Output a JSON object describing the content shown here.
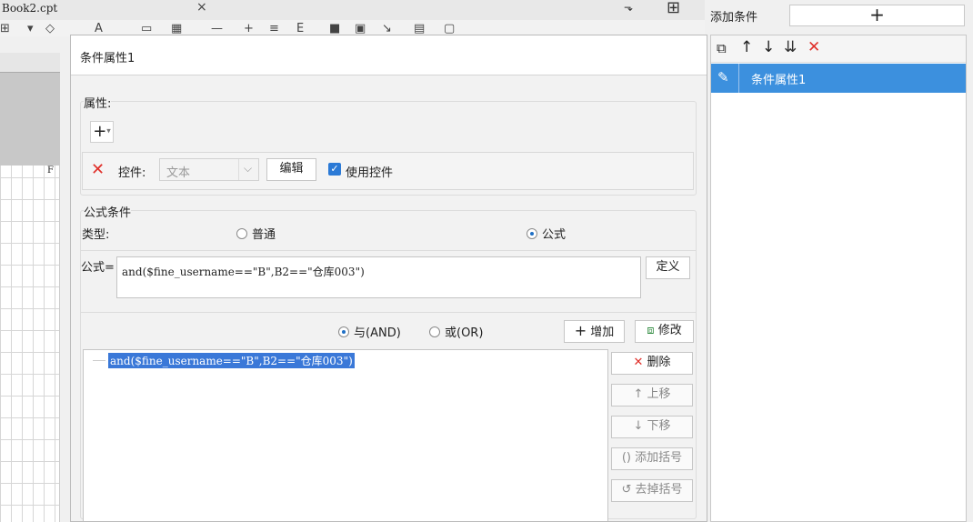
{
  "background": {
    "tab_title": "Book2.cpt",
    "tab_close": "×",
    "pin_glyph": "⬎",
    "layout_glyph": "⊞",
    "toolbar_glyphs": [
      "⊞",
      "▾",
      "◇",
      "A",
      "▭",
      "▦",
      "—",
      "+",
      "≡",
      "E",
      "■",
      "▣",
      "↘",
      "▤",
      "▢"
    ],
    "column_header": "F"
  },
  "right_panel": {
    "add_condition_label": "添加条件",
    "add_condition_button": "+",
    "tools": {
      "copy": "⧉",
      "move_up": "↑",
      "move_down": "↓",
      "move_bottom": "⇊",
      "delete": "✕"
    },
    "items": [
      {
        "label": "条件属性1",
        "icon": "pencil-icon",
        "selected": true
      }
    ],
    "selected_color": "#3c90de"
  },
  "dialog": {
    "title": "条件属性1",
    "properties": {
      "legend": "属性:",
      "add_button": "+",
      "add_dropdown": "▾",
      "remove_glyph": "✕",
      "control_label": "控件:",
      "control_select_value": "文本",
      "edit_button": "编辑",
      "use_control_checked": true,
      "use_control_label": "使用控件"
    },
    "formula_condition": {
      "legend": "公式条件",
      "type_label": "类型:",
      "option_normal": "普通",
      "option_formula": "公式",
      "selected_type": "公式",
      "formula_label": "公式=",
      "formula_value": "and($fine_username==\"B\",B2==\"仓库003\")",
      "define_button": "定义"
    },
    "logic": {
      "and_label": "与(AND)",
      "or_label": "或(OR)",
      "selected": "and",
      "add_button": "增加",
      "add_glyph": "+",
      "modify_button": "修改",
      "modify_glyph": "⧈"
    },
    "condition_list": [
      "and($fine_username==\"B\",B2==\"仓库003\")"
    ],
    "side_buttons": {
      "delete": "删除",
      "delete_glyph": "✕",
      "move_up": "上移",
      "move_up_glyph": "↑",
      "move_down": "下移",
      "move_down_glyph": "↓",
      "add_parens": "添加括号",
      "add_parens_glyph": "()",
      "remove_parens": "去掉括号",
      "remove_parens_glyph": "↺"
    },
    "accent_color": "#1f6fc5",
    "delete_color": "#e0302a"
  }
}
